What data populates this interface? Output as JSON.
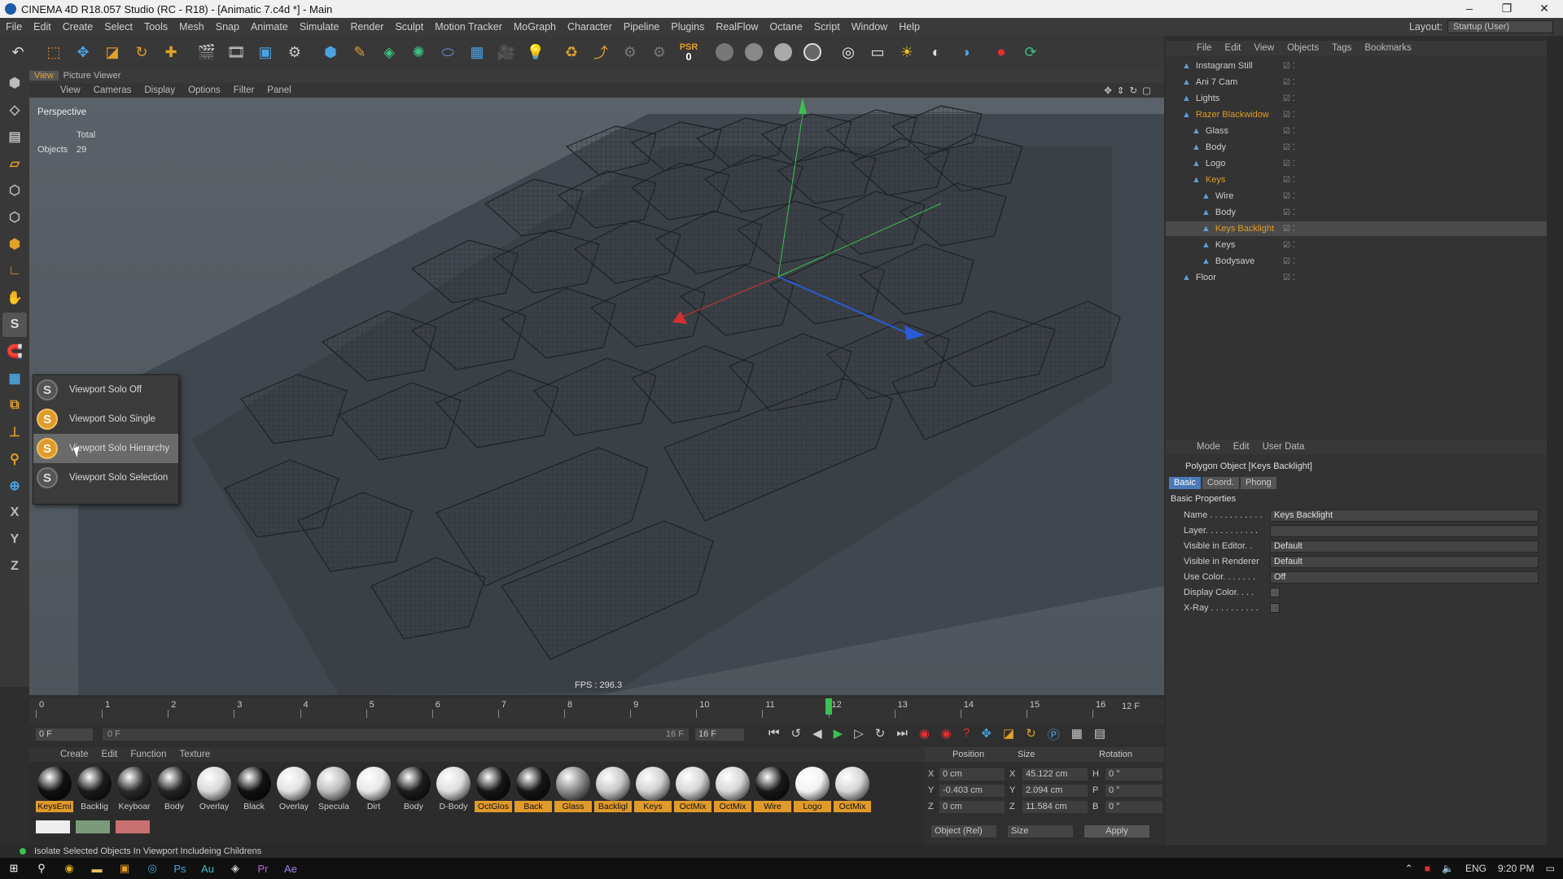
{
  "window": {
    "title": "CINEMA 4D R18.057 Studio (RC - R18) - [Animatic 7.c4d *] - Main"
  },
  "menu": [
    "File",
    "Edit",
    "Create",
    "Select",
    "Tools",
    "Mesh",
    "Snap",
    "Animate",
    "Simulate",
    "Render",
    "Sculpt",
    "Motion Tracker",
    "MoGraph",
    "Character",
    "Pipeline",
    "Plugins",
    "RealFlow",
    "Octane",
    "Script",
    "Window",
    "Help"
  ],
  "layout": {
    "label": "Layout:",
    "value": "Startup (User)"
  },
  "toolbar": {
    "psr_label": "PSR",
    "psr_value": "0"
  },
  "viewport": {
    "tabs": [
      "View",
      "Picture Viewer"
    ],
    "menu": [
      "View",
      "Cameras",
      "Display",
      "Options",
      "Filter",
      "Panel"
    ],
    "name": "Perspective",
    "total_label": "Total",
    "objects_label": "Objects",
    "objects_value": "29",
    "fps": "FPS : 296.3"
  },
  "solo_menu": {
    "items": [
      {
        "label": "Viewport Solo Off"
      },
      {
        "label": "Viewport Solo Single"
      },
      {
        "label": "Viewport Solo Hierarchy"
      },
      {
        "label": "Viewport Solo Selection"
      }
    ]
  },
  "timeline": {
    "ticks": [
      "0",
      "1",
      "2",
      "3",
      "4",
      "5",
      "6",
      "7",
      "8",
      "9",
      "10",
      "11",
      "12",
      "13",
      "14",
      "15",
      "16"
    ],
    "current_frame": 12,
    "end_label": "12 F",
    "start_field": "0 F",
    "range_start": "0 F",
    "range_end": "16 F",
    "end_field": "16 F"
  },
  "materials": {
    "menu": [
      "Create",
      "Edit",
      "Function",
      "Texture"
    ],
    "items": [
      {
        "label": "KeysEmi",
        "color": "#111111",
        "highlight": true
      },
      {
        "label": "Backlig",
        "color": "#1b1b1b",
        "highlight": false
      },
      {
        "label": "Keyboar",
        "color": "#2a2a2a",
        "highlight": false
      },
      {
        "label": "Body",
        "color": "#252525",
        "highlight": false
      },
      {
        "label": "Overlay",
        "color": "#d8d8d8",
        "highlight": false
      },
      {
        "label": "Black",
        "color": "#111111",
        "highlight": false
      },
      {
        "label": "Overlay",
        "color": "#e0e0e0",
        "highlight": false
      },
      {
        "label": "Specula",
        "color": "#bdbdbd",
        "highlight": false
      },
      {
        "label": "Dirt",
        "color": "#e6e6e6",
        "highlight": false
      },
      {
        "label": "Body",
        "color": "#1c1c1c",
        "highlight": false
      },
      {
        "label": "D-Body",
        "color": "#dcdcdc",
        "highlight": false
      },
      {
        "label": "OctGlos",
        "color": "#151515",
        "highlight": true
      },
      {
        "label": "Back",
        "color": "#151515",
        "highlight": true
      },
      {
        "label": "Glass",
        "color": "#8a8a8a",
        "highlight": true
      },
      {
        "label": "Backligl",
        "color": "#c8c8c8",
        "highlight": true
      },
      {
        "label": "Keys",
        "color": "#d0d0d0",
        "highlight": true
      },
      {
        "label": "OctMix",
        "color": "#d6d6d6",
        "highlight": true
      },
      {
        "label": "OctMix",
        "color": "#d6d6d6",
        "highlight": true
      },
      {
        "label": "Wire",
        "color": "#181818",
        "highlight": true
      },
      {
        "label": "Logo",
        "color": "#f2f2f2",
        "highlight": true
      },
      {
        "label": "OctMix",
        "color": "#d6d6d6",
        "highlight": true
      }
    ]
  },
  "coords": {
    "headers": [
      "Position",
      "Size",
      "Rotation"
    ],
    "rows": [
      {
        "axis": "X",
        "pos": "0 cm",
        "saxis": "X",
        "size": "45.122 cm",
        "raxis": "H",
        "rot": "0 °"
      },
      {
        "axis": "Y",
        "pos": "-0.403 cm",
        "saxis": "Y",
        "size": "2.094 cm",
        "raxis": "P",
        "rot": "0 °"
      },
      {
        "axis": "Z",
        "pos": "0 cm",
        "saxis": "Z",
        "size": "11.584 cm",
        "raxis": "B",
        "rot": "0 °"
      }
    ],
    "mode": "Object (Rel)",
    "size_mode": "Size",
    "apply": "Apply"
  },
  "object_manager": {
    "menu": [
      "File",
      "Edit",
      "View",
      "Objects",
      "Tags",
      "Bookmarks"
    ],
    "objects": [
      {
        "name": "Instagram Still",
        "indent": 0,
        "orange": false,
        "selected": false
      },
      {
        "name": "Ani 7 Cam",
        "indent": 0,
        "orange": false,
        "selected": false
      },
      {
        "name": "Lights",
        "indent": 0,
        "orange": false,
        "selected": false
      },
      {
        "name": "Razer Blackwidow",
        "indent": 0,
        "orange": true,
        "selected": false
      },
      {
        "name": "Glass",
        "indent": 1,
        "orange": false,
        "selected": false
      },
      {
        "name": "Body",
        "indent": 1,
        "orange": false,
        "selected": false
      },
      {
        "name": "Logo",
        "indent": 1,
        "orange": false,
        "selected": false
      },
      {
        "name": "Keys",
        "indent": 1,
        "orange": true,
        "selected": false
      },
      {
        "name": "Wire",
        "indent": 2,
        "orange": false,
        "selected": false
      },
      {
        "name": "Body",
        "indent": 2,
        "orange": false,
        "selected": false
      },
      {
        "name": "Keys Backlight",
        "indent": 2,
        "orange": true,
        "selected": true
      },
      {
        "name": "Keys",
        "indent": 2,
        "orange": false,
        "selected": false
      },
      {
        "name": "Bodysave",
        "indent": 2,
        "orange": false,
        "selected": false
      },
      {
        "name": "Floor",
        "indent": 0,
        "orange": false,
        "selected": false
      }
    ]
  },
  "attributes": {
    "menu": [
      "Mode",
      "Edit",
      "User Data"
    ],
    "title": "Polygon Object [Keys Backlight]",
    "tabs": [
      "Basic",
      "Coord.",
      "Phong"
    ],
    "section": "Basic Properties",
    "fields": [
      {
        "label": "Name . . . . . . . . . . .",
        "value": "Keys Backlight"
      },
      {
        "label": "Layer. . . . . . . . . . .",
        "value": ""
      },
      {
        "label": "Visible in Editor. .",
        "value": "Default"
      },
      {
        "label": "Visible in Renderer",
        "value": "Default"
      },
      {
        "label": "Use Color. . . . . . .",
        "value": "Off"
      },
      {
        "label": "Display Color. . . .",
        "value": ""
      },
      {
        "label": "X-Ray . . . . . . . . . .",
        "value": ""
      }
    ]
  },
  "status": {
    "text": "Isolate Selected Objects In Viewport Includeing Childrens"
  },
  "tray": {
    "lang": "ENG",
    "time": "9:20 PM"
  }
}
